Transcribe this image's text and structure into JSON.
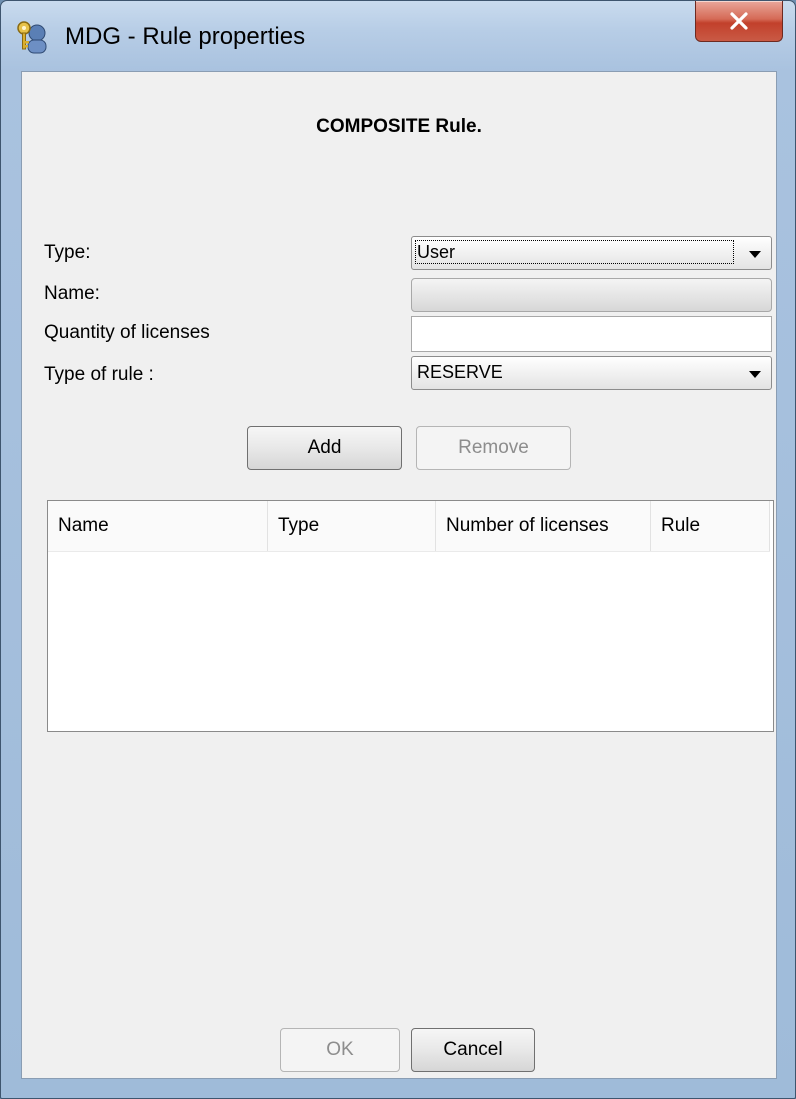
{
  "window": {
    "title": "MDG - Rule properties"
  },
  "heading": "COMPOSITE Rule.",
  "form": {
    "type_label": "Type:",
    "type_value": "User",
    "name_label": "Name:",
    "name_value": "",
    "quantity_label": "Quantity of licenses",
    "quantity_value": "",
    "rule_type_label": "Type of rule :",
    "rule_type_value": "RESERVE"
  },
  "buttons": {
    "add": "Add",
    "remove": "Remove",
    "ok": "OK",
    "cancel": "Cancel"
  },
  "table": {
    "columns": [
      "Name",
      "Type",
      "Number of licenses",
      "Rule"
    ],
    "rows": []
  },
  "icons": {
    "app": "key-user-icon",
    "close": "close-icon",
    "dropdown": "chevron-down-icon"
  }
}
